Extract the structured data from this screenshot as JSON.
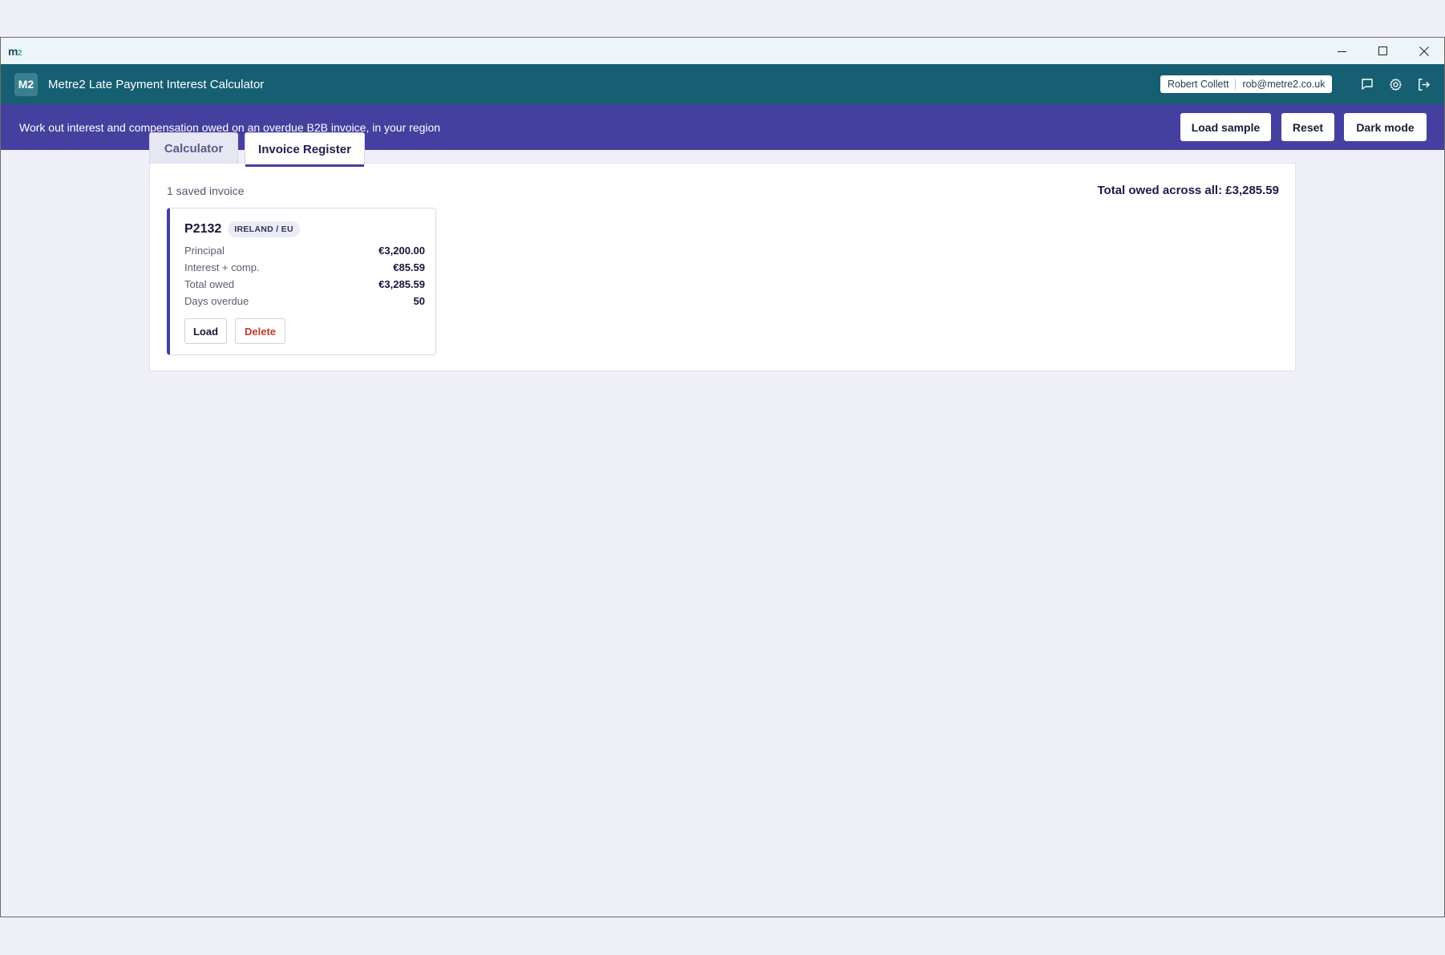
{
  "titlebar": {
    "logo": "m",
    "logo_sup": "2"
  },
  "appbar": {
    "badge": "M2",
    "title": "Metre2 Late Payment Interest Calculator",
    "user_name": "Robert Collett",
    "user_email": "rob@metre2.co.uk"
  },
  "banner": {
    "text": "Work out interest and compensation owed on an overdue B2B invoice, in your region",
    "load_sample": "Load sample",
    "reset": "Reset",
    "dark_mode": "Dark mode"
  },
  "tabs": [
    {
      "label": "Calculator"
    },
    {
      "label": "Invoice Register"
    }
  ],
  "register": {
    "saved_count": "1 saved invoice",
    "total_all": "Total owed across all: £3,285.59",
    "invoices": [
      {
        "id": "P2132",
        "region": "IRELAND / EU",
        "rows": [
          {
            "label": "Principal",
            "value": "€3,200.00"
          },
          {
            "label": "Interest + comp.",
            "value": "€85.59"
          },
          {
            "label": "Total owed",
            "value": "€3,285.59"
          },
          {
            "label": "Days overdue",
            "value": "50"
          }
        ],
        "load_label": "Load",
        "delete_label": "Delete"
      }
    ]
  },
  "colors": {
    "appbar": "#165f73",
    "banner": "#4540a0",
    "delete": "#c0392b"
  }
}
